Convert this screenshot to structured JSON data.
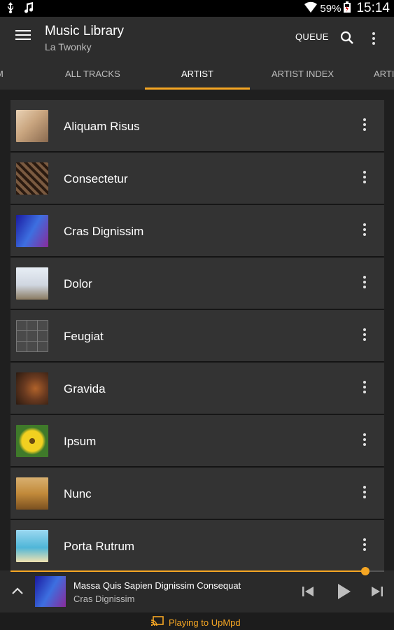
{
  "status_bar": {
    "battery": "59%",
    "time": "15:14",
    "icons": [
      "usb-icon",
      "music-note-icon",
      "wifi-icon",
      "battery-icon"
    ]
  },
  "app_bar": {
    "title": "Music Library",
    "subtitle": "La Twonky",
    "queue_label": "QUEUE",
    "icons": [
      "menu-icon",
      "search-icon",
      "more-vert-icon"
    ]
  },
  "tabs": [
    {
      "label": "M",
      "active": false
    },
    {
      "label": "ALL TRACKS",
      "active": false
    },
    {
      "label": "ARTIST",
      "active": true
    },
    {
      "label": "ARTIST INDEX",
      "active": false
    },
    {
      "label": "ARTI",
      "active": false
    }
  ],
  "accent_color": "#f5a623",
  "artists": [
    {
      "name": "Aliquam Risus",
      "thumb": "#c9a57f"
    },
    {
      "name": "Consectetur",
      "thumb": "#6b4a35"
    },
    {
      "name": "Cras Dignissim",
      "thumb": "#2b3fb0"
    },
    {
      "name": "Dolor",
      "thumb": "#cfd6e0"
    },
    {
      "name": "Feugiat",
      "thumb": "#4a4a4a"
    },
    {
      "name": "Gravida",
      "thumb": "#6a3a20"
    },
    {
      "name": "Ipsum",
      "thumb": "#e7c21a"
    },
    {
      "name": "Nunc",
      "thumb": "#c28a3a"
    },
    {
      "name": "Porta Rutrum",
      "thumb": "#4fb6d8"
    }
  ],
  "now_playing": {
    "title": "Massa Quis Sapien Dignissim Consequat",
    "artist": "Cras Dignissim",
    "progress": 0.95
  },
  "cast": {
    "label": "Playing to UpMpd",
    "icon": "cast-icon"
  }
}
